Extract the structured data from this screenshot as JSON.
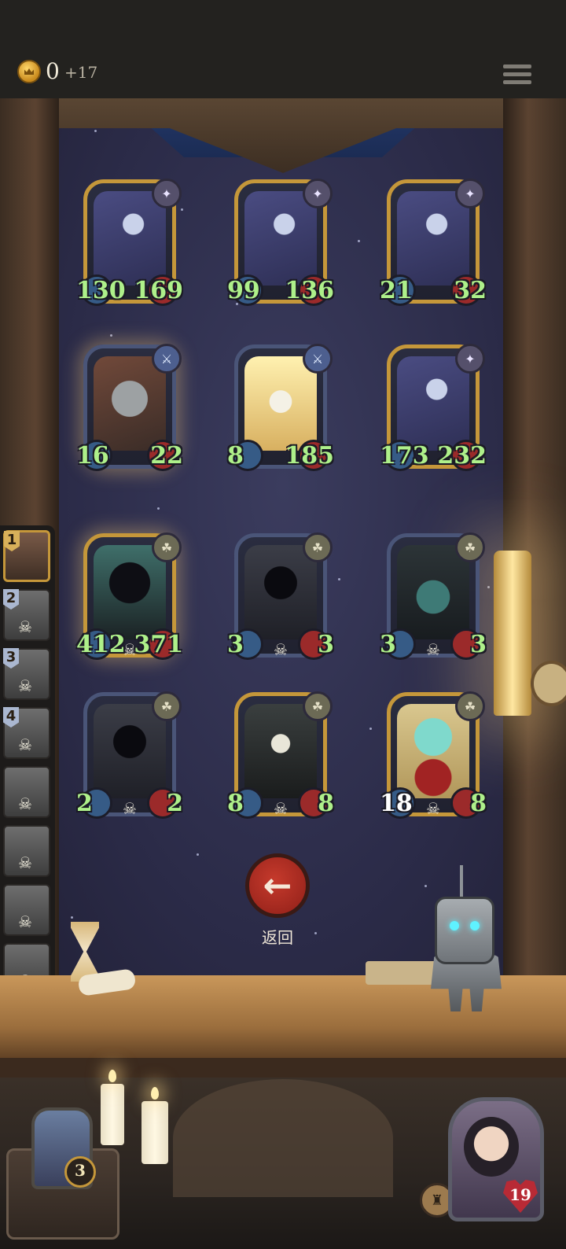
{
  "header": {
    "gold": "0",
    "gold_income": "+17",
    "coin_icon": "coin-icon",
    "menu_icon": "menu-icon"
  },
  "board": {
    "cards": [
      {
        "name": "bandit",
        "attack": "130",
        "health": "169",
        "tribe_icon": "sparkle-icon",
        "frame": "gold"
      },
      {
        "name": "bandit",
        "attack": "99",
        "health": "136",
        "tribe_icon": "sparkle-icon",
        "frame": "gold"
      },
      {
        "name": "bandit",
        "attack": "21",
        "health": "32",
        "tribe_icon": "sparkle-icon",
        "frame": "gold"
      },
      {
        "name": "orc",
        "attack": "16",
        "health": "22",
        "tribe_icon": "sword-icon",
        "frame": "blue"
      },
      {
        "name": "dwarf",
        "attack": "8",
        "health": "185",
        "tribe_icon": "sword-icon",
        "frame": "blue"
      },
      {
        "name": "bandit",
        "attack": "173",
        "health": "232",
        "tribe_icon": "sparkle-icon",
        "frame": "gold"
      },
      {
        "name": "lich",
        "attack": "412",
        "health": "371",
        "tribe_icon": "claw-icon",
        "frame": "gold"
      },
      {
        "name": "hood",
        "attack": "3",
        "health": "3",
        "tribe_icon": "claw-icon",
        "frame": "blue"
      },
      {
        "name": "beast",
        "attack": "3",
        "health": "3",
        "tribe_icon": "claw-icon",
        "frame": "blue"
      },
      {
        "name": "hood",
        "attack": "2",
        "health": "2",
        "tribe_icon": "claw-icon",
        "frame": "blue"
      },
      {
        "name": "reaper",
        "attack": "8",
        "health": "8",
        "tribe_icon": "claw-icon",
        "frame": "gold"
      },
      {
        "name": "ghost",
        "attack": "18",
        "health": "8",
        "tribe_icon": "claw-icon",
        "frame": "gold"
      }
    ]
  },
  "back_button": {
    "label": "返回",
    "icon": "arrow-left-icon"
  },
  "queue": {
    "items": [
      {
        "rank": "1",
        "state": "active"
      },
      {
        "rank": "2",
        "state": "dead"
      },
      {
        "rank": "3",
        "state": "dead"
      },
      {
        "rank": "4",
        "state": "dead"
      },
      {
        "rank": "",
        "state": "dead"
      },
      {
        "rank": "",
        "state": "dead"
      },
      {
        "rank": "",
        "state": "dead"
      },
      {
        "rank": "",
        "state": "dead"
      }
    ]
  },
  "footer": {
    "deck_count": "3",
    "hero_health": "19",
    "ability_icon": "helmet-icon"
  },
  "colors": {
    "accent_gold": "#c5973a",
    "attack_green": "#aef08a",
    "back_red": "#c63a2c"
  }
}
